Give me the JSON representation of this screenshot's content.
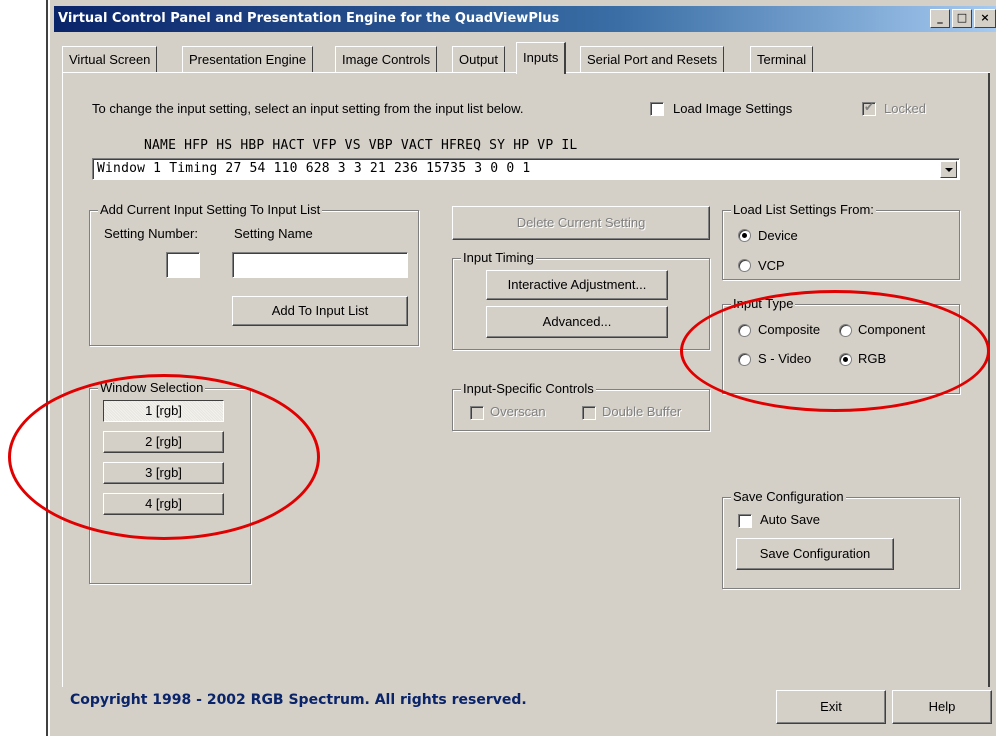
{
  "window": {
    "title": "Virtual Control Panel and Presentation Engine for the QuadViewPlus",
    "minimize_glyph": "_",
    "maximize_glyph": "□",
    "close_glyph": "×"
  },
  "tabs": [
    {
      "label": "Virtual Screen"
    },
    {
      "label": "Presentation Engine"
    },
    {
      "label": "Image Controls"
    },
    {
      "label": "Output"
    },
    {
      "label": "Inputs"
    },
    {
      "label": "Serial Port and Resets"
    },
    {
      "label": "Terminal"
    }
  ],
  "inputs": {
    "instruction": "To change the input setting, select an input setting from the input list below.",
    "load_image_settings": {
      "label": "Load Image Settings",
      "checked": false
    },
    "locked": {
      "label": "Locked",
      "checked": true,
      "disabled": true
    },
    "list_header": "NAME            HFP  HS   HBP  HACT  VFP  VS  VBP  VACT  HFREQ  SY  HP  VP  IL",
    "selected_setting": "Window  1  Timing       27   54   110  628   3    3   21   236   15735  3   0   0   1"
  },
  "add_setting": {
    "group_label": "Add Current Input Setting To Input List",
    "number_label": "Setting Number:",
    "name_label": "Setting Name",
    "number_value": "",
    "name_value": "",
    "add_button": "Add To Input List"
  },
  "delete_button": "Delete Current Setting",
  "input_timing": {
    "group_label": "Input Timing",
    "interactive_button": "Interactive Adjustment...",
    "advanced_button": "Advanced..."
  },
  "load_list": {
    "group_label": "Load List Settings From:",
    "options": [
      {
        "label": "Device",
        "selected": true
      },
      {
        "label": "VCP",
        "selected": false
      }
    ]
  },
  "input_type": {
    "group_label": "Input Type",
    "options": [
      {
        "label": "Composite",
        "selected": false
      },
      {
        "label": "Component",
        "selected": false
      },
      {
        "label": "S - Video",
        "selected": false
      },
      {
        "label": "RGB",
        "selected": true
      }
    ]
  },
  "window_selection": {
    "group_label": "Window Selection",
    "buttons": [
      {
        "label": "1 [rgb]",
        "pressed": true
      },
      {
        "label": "2 [rgb]",
        "pressed": false
      },
      {
        "label": "3 [rgb]",
        "pressed": false
      },
      {
        "label": "4 [rgb]",
        "pressed": false
      }
    ]
  },
  "input_specific": {
    "group_label": "Input-Specific Controls",
    "overscan": "Overscan",
    "double_buffer": "Double Buffer"
  },
  "save_config": {
    "group_label": "Save Configuration",
    "auto_save": {
      "label": "Auto Save",
      "checked": false
    },
    "save_button": "Save Configuration"
  },
  "footer": {
    "copyright": "Copyright 1998 - 2002 RGB Spectrum.  All rights reserved.",
    "exit_button": "Exit",
    "help_button": "Help"
  },
  "colors": {
    "face": "#d4d0c8",
    "title_start": "#0a246a",
    "annotation_red": "#e00000",
    "copyright_blue": "#0a246a"
  }
}
